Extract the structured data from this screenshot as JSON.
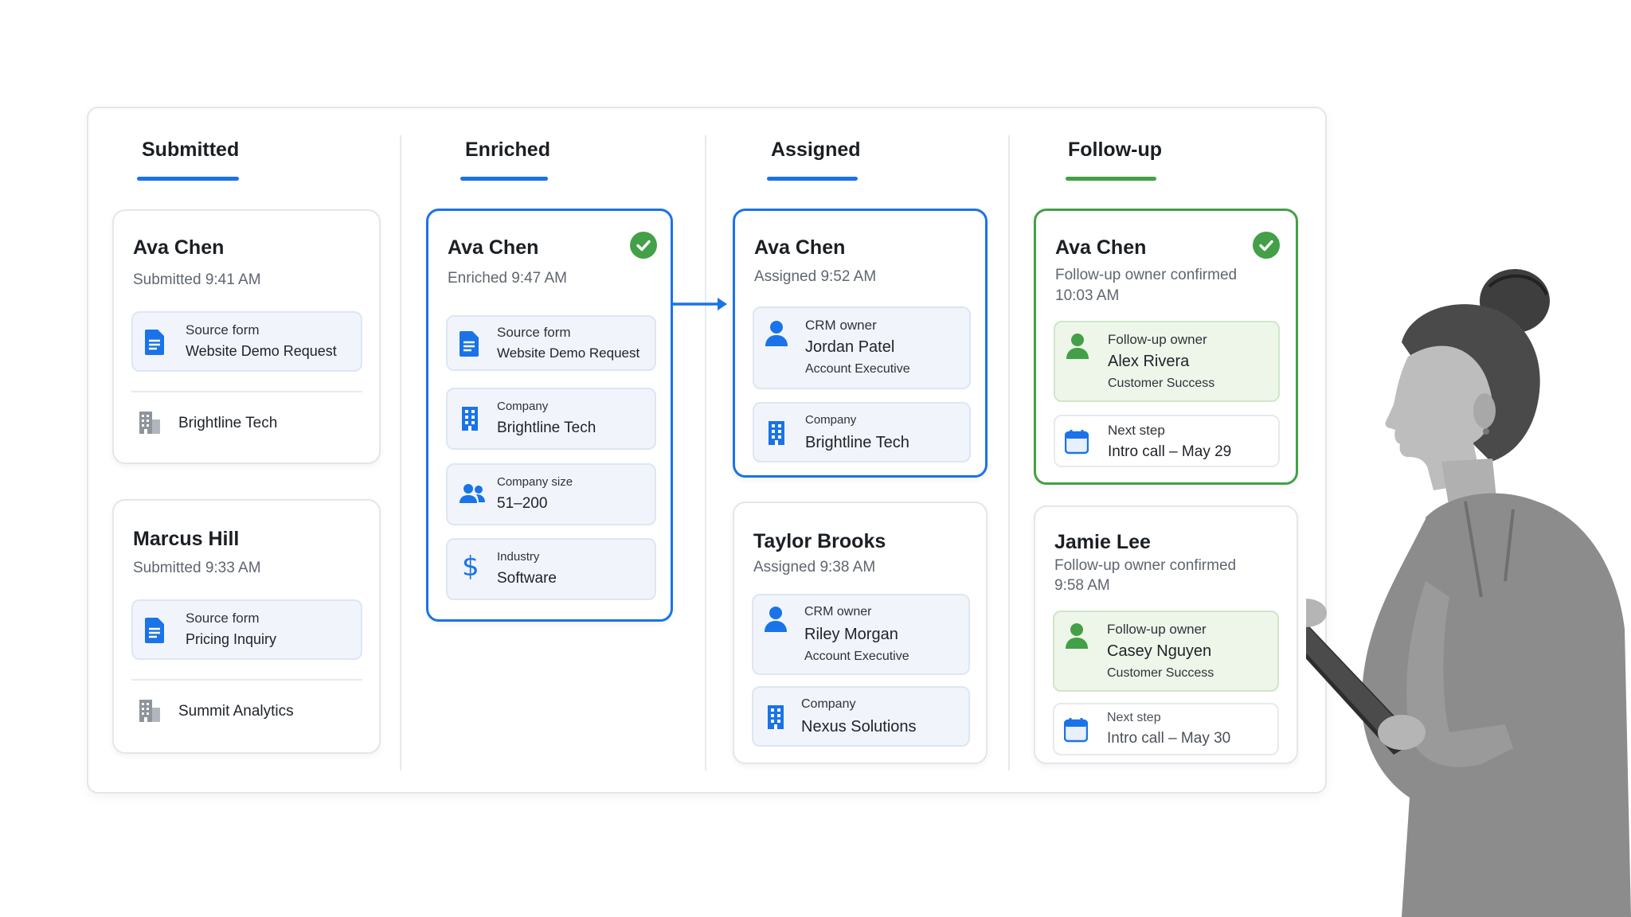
{
  "columns": [
    {
      "title": "Submitted"
    },
    {
      "title": "Enriched"
    },
    {
      "title": "Assigned"
    },
    {
      "title": "Follow-up"
    }
  ],
  "submitted": [
    {
      "name": "Ava Chen",
      "status": "Submitted 9:41 AM",
      "field_label": "Source form",
      "field_value": "Website Demo Request",
      "company": "Brightline Tech"
    },
    {
      "name": "Marcus Hill",
      "status": "Submitted 9:33 AM",
      "field_label": "Source form",
      "field_value": "Pricing Inquiry",
      "company": "Summit Analytics"
    }
  ],
  "enriched": {
    "name": "Ava Chen",
    "status": "Enriched 9:47 AM",
    "fields": [
      {
        "label": "Source form",
        "value": "Website Demo Request",
        "icon": "document-icon"
      },
      {
        "label": "Company",
        "value": "Brightline Tech",
        "icon": "building-icon"
      },
      {
        "label": "Company size",
        "value": "51–200",
        "icon": "people-icon"
      },
      {
        "label": "Industry",
        "value": "Software",
        "icon": "dollar-icon"
      }
    ]
  },
  "assigned": [
    {
      "name": "Ava Chen",
      "status": "Assigned 9:52 AM",
      "owner_label": "CRM owner",
      "owner_name": "Jordan Patel",
      "owner_role": "Account Executive",
      "company_label": "Company",
      "company": "Brightline Tech"
    },
    {
      "name": "Taylor Brooks",
      "status": "Assigned 9:38 AM",
      "owner_label": "CRM owner",
      "owner_name": "Riley Morgan",
      "owner_role": "Account Executive",
      "company_label": "Company",
      "company": "Nexus Solutions"
    }
  ],
  "followup": [
    {
      "name": "Ava Chen",
      "status_line1": "Follow-up owner confirmed",
      "status_line2": "10:03 AM",
      "owner_label": "Follow-up owner",
      "owner_name": "Alex Rivera",
      "owner_role": "Customer Success",
      "step_label": "Next step",
      "step_value": "Intro call – May 29"
    },
    {
      "name": "Jamie Lee",
      "status_line1": "Follow-up owner confirmed",
      "status_line2": "9:58 AM",
      "owner_label": "Follow-up owner",
      "owner_name": "Casey Nguyen",
      "owner_role": "Customer Success",
      "step_label": "Next step",
      "step_value": "Intro call – May 30"
    }
  ],
  "colors": {
    "blue": "#1a73e8",
    "green": "#43a047",
    "border": "#e3e6ea"
  }
}
